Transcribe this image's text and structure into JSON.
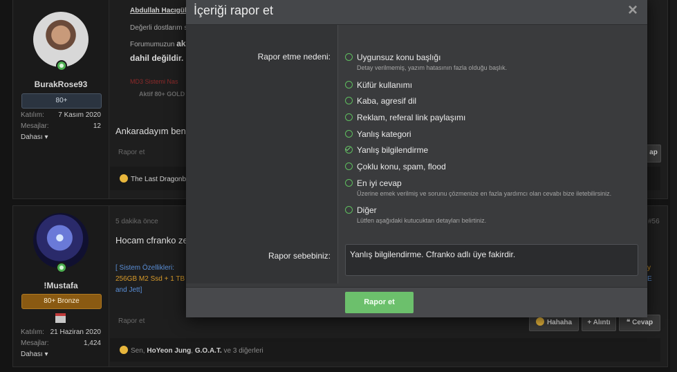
{
  "post1": {
    "quote_author": "Abdullah Hacıgül",
    "quote_line1": "Değerli dostlarım s",
    "quote_line2_prefix": "Forumumuzun",
    "quote_line2_bold": "ak",
    "quote_line3": "dahil değildir.",
    "quote_red1": "MD3 Sistemi Nas",
    "quote_red2": "Aktif 80+ GOLD",
    "user": {
      "name": "BurakRose93",
      "rank": "80+",
      "joined_label": "Katılım:",
      "joined": "7 Kasım 2020",
      "messages_label": "Mesajlar:",
      "messages": "12",
      "more": "Dahası"
    },
    "body": "Ankaradayım ben h",
    "report_link": "Rapor et",
    "reply_btn": "ap",
    "reaction": "The Last Dragonbo"
  },
  "post2": {
    "time": "5 dakika önce",
    "post_number": "#56",
    "body": "Hocam cfranko zen",
    "sig1": "[ Sistem Özellikleri: ",
    "sig2": "256GB M2 Ssd + 1 TB S",
    "sig3": "and Jett]",
    "sig_right1": "y",
    "sig_right2": "E",
    "user": {
      "name": "!Mustafa",
      "rank": "80+ Bronze",
      "joined_label": "Katılım:",
      "joined": "21 Haziran 2020",
      "messages_label": "Mesajlar:",
      "messages": "1,424",
      "more": "Dahası"
    },
    "report_link": "Rapor et",
    "buttons": {
      "haha": "Hahaha",
      "quote": "+ Alıntı",
      "reply": "Cevap"
    },
    "reactions": {
      "prefix": "Sen, ",
      "user1": "HoYeon Jung",
      "sep": ", ",
      "user2": "G.O.A.T.",
      "suffix": " ve 3 diğerleri"
    }
  },
  "modal": {
    "title": "İçeriği rapor et",
    "close": "×",
    "reason_label": "Rapor etme nedeni:",
    "options": [
      {
        "label": "Uygunsuz konu başlığı",
        "hint": "Detay verilmemiş, yazım hatasının fazla olduğu başlık.",
        "checked": false
      },
      {
        "label": "Küfür kullanımı",
        "hint": "",
        "checked": false
      },
      {
        "label": "Kaba, agresif dil",
        "hint": "",
        "checked": false
      },
      {
        "label": "Reklam, referal link paylaşımı",
        "hint": "",
        "checked": false
      },
      {
        "label": "Yanlış kategori",
        "hint": "",
        "checked": false
      },
      {
        "label": "Yanlış bilgilendirme",
        "hint": "",
        "checked": true
      },
      {
        "label": "Çoklu konu, spam, flood",
        "hint": "",
        "checked": false
      },
      {
        "label": "En iyi cevap",
        "hint": "Üzerine emek verilmiş ve sorunu çözmenize en fazla yardımcı olan cevabı bize iletebilirsiniz.",
        "checked": false
      },
      {
        "label": "Diğer",
        "hint": "Lütfen aşağıdaki kutucuktan detayları belirtiniz.",
        "checked": false
      }
    ],
    "message_label": "Rapor sebebiniz:",
    "message_value": "Yanlış bilgilendirme. Cfranko adlı üye fakirdir.",
    "submit": "Rapor et",
    "accent": "#6cc06c"
  }
}
